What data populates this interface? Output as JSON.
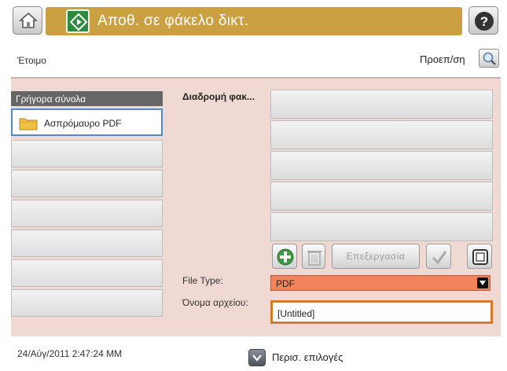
{
  "header": {
    "title": "Αποθ. σε φάκελο δικτ.",
    "home_icon": "home-icon",
    "help_icon": "help-icon"
  },
  "status": {
    "text": "Έτοιμο",
    "preview_label": "Προεπ/ση"
  },
  "quick_sets": {
    "title": "Γρήγορα σύνολα",
    "items": [
      "Ασπρόμαυρο PDF",
      "",
      "",
      "",
      "",
      "",
      "",
      ""
    ]
  },
  "folder_path": {
    "label": "Διαδρομή φακ..."
  },
  "toolbar": {
    "add_icon": "add-icon",
    "delete_icon": "trash-icon",
    "edit_label": "Επεξεργασία",
    "check_icon": "checkmark-icon",
    "book_icon": "address-book-icon"
  },
  "file_type": {
    "label": "File Type:",
    "value": "PDF"
  },
  "file_name": {
    "label": "Όνομα αρχείου:",
    "value": "[Untitled]"
  },
  "footer": {
    "datetime": "24/Αύγ/2011 2:47:24 ΜΜ",
    "more_options_label": "Περισ. επιλογές"
  },
  "colors": {
    "title_band": "#caa043",
    "panel_bg": "#efd9d2",
    "file_type_bg": "#f2845b",
    "file_name_border": "#d47a2a",
    "selected_border": "#4d8ac9"
  }
}
